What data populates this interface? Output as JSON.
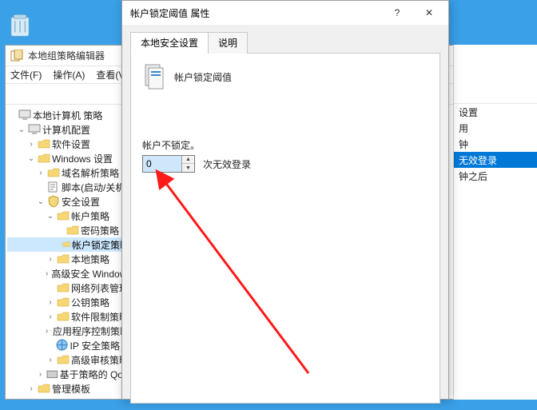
{
  "desktop": {
    "recycle_bin": "回收站"
  },
  "editor": {
    "title": "本地组策略编辑器",
    "menu": {
      "file": "文件(F)",
      "action": "操作(A)",
      "view": "查看(V)"
    }
  },
  "tree": {
    "root": "本地计算机 策略",
    "computer_config": "计算机配置",
    "software_settings": "软件设置",
    "windows_settings": "Windows 设置",
    "name_resolution": "域名解析策略",
    "scripts": "脚本(启动/关机)",
    "security_settings": "安全设置",
    "account_policies": "帐户策略",
    "password_policy": "密码策略",
    "lockout_policy": "帐户锁定策略",
    "local_policies": "本地策略",
    "advanced_firewall": "高级安全 Windows",
    "network_list": "网络列表管理",
    "public_key": "公钥策略",
    "software_restriction": "软件限制策略",
    "app_control": "应用程序控制策略",
    "ip_security": "IP 安全策略，",
    "advanced_audit": "高级审核策略",
    "qos": "基于策略的 QoS",
    "admin_templates": "管理模板"
  },
  "right_pane": {
    "items": [
      "设置",
      "用",
      "钟",
      "无效登录",
      "钟之后"
    ]
  },
  "dialog": {
    "title": "帐户锁定阈值 属性",
    "help_label": "?",
    "close_label": "✕",
    "tabs": {
      "local": "本地安全设置",
      "explain": "说明"
    },
    "policy_name": "帐户锁定阈值",
    "field_label": "帐户不锁定。",
    "value": "0",
    "suffix": "次无效登录"
  }
}
